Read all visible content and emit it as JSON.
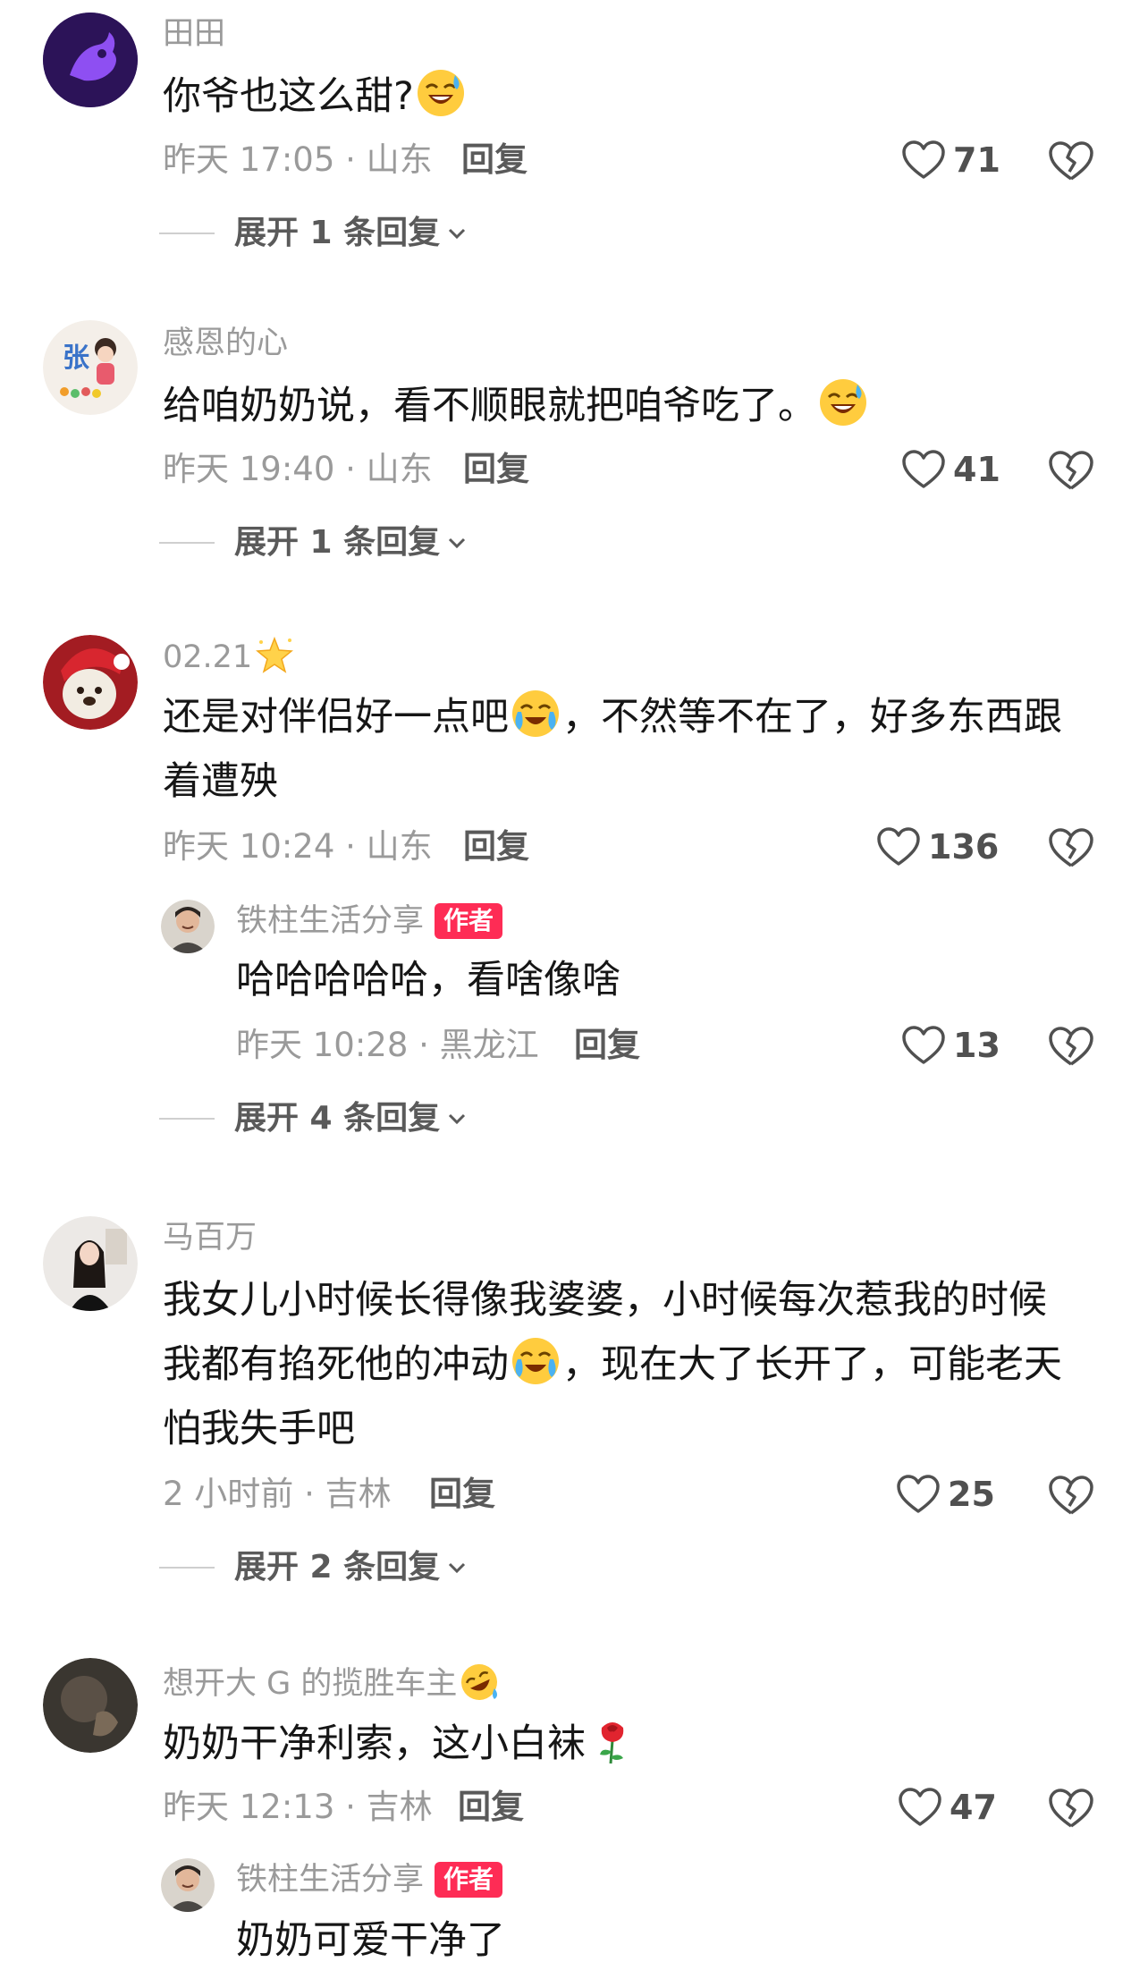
{
  "comments": [
    {
      "username": "田田",
      "text": "你爷也这么甜?",
      "text_emoji": "grinning-sweat-emoji",
      "time": "昨天 17:05 · 山东",
      "reply_label": "回复",
      "likes": "71",
      "expand_label": "展开 1 条回复"
    },
    {
      "username": "感恩的心",
      "text": "给咱奶奶说，看不顺眼就把咱爷吃了。",
      "text_emoji": "grinning-sweat-emoji",
      "time": "昨天 19:40 · 山东",
      "reply_label": "回复",
      "likes": "41",
      "expand_label": "展开 1 条回复"
    },
    {
      "username": "02.21",
      "username_emoji": "star-emoji",
      "text_line1_a": "还是对伴侣好一点吧",
      "text_line1_b": "，不然等不在了，好多东西跟",
      "text_line2": "着遭殃",
      "time": "昨天 10:24 · 山东",
      "reply_label": "回复",
      "likes": "136",
      "reply": {
        "username": "铁柱生活分享",
        "badge": "作者",
        "text": "哈哈哈哈哈，看啥像啥",
        "time": "昨天 10:28 · 黑龙江",
        "reply_label": "回复",
        "likes": "13"
      },
      "expand_label": "展开 4 条回复"
    },
    {
      "username": "马百万",
      "text_line1": "我女儿小时候长得像我婆婆，小时候每次惹我的时候",
      "text_line2_a": "我都有掐死他的冲动",
      "text_line2_b": "，现在大了长开了，可能老天",
      "text_line3": "怕我失手吧",
      "time": "2 小时前 · 吉林",
      "reply_label": "回复",
      "likes": "25",
      "expand_label": "展开 2 条回复"
    },
    {
      "username": "想开大 G 的揽胜车主",
      "username_emoji": "rofl-emoji",
      "text": "奶奶干净利索，这小白袜",
      "text_emoji": "rose-emoji",
      "time": "昨天 12:13 · 吉林",
      "reply_label": "回复",
      "likes": "47",
      "reply": {
        "username": "铁柱生活分享",
        "badge": "作者",
        "text": "奶奶可爱干净了"
      }
    }
  ],
  "colors": {
    "accent_badge": "#fe2c55",
    "meta_gray": "#9a9a9a",
    "text": "#161616"
  }
}
